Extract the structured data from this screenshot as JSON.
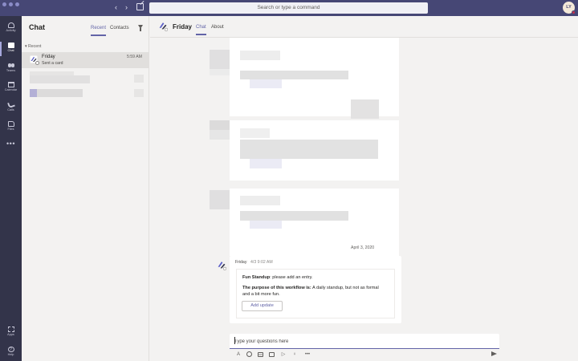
{
  "titlebar": {
    "back_icon": "chevron-left-icon",
    "forward_icon": "chevron-right-icon",
    "compose_icon": "compose-icon",
    "search_placeholder": "Search or type a command",
    "user_initials": "LY"
  },
  "appbar": {
    "items": [
      {
        "label": "Activity",
        "icon": "bell-icon"
      },
      {
        "label": "Chat",
        "icon": "chat-icon"
      },
      {
        "label": "Teams",
        "icon": "teams-icon"
      },
      {
        "label": "Calendar",
        "icon": "calendar-icon"
      },
      {
        "label": "Calls",
        "icon": "phone-icon"
      },
      {
        "label": "Files",
        "icon": "file-icon"
      }
    ],
    "more_label": "•••",
    "apps_label": "Apps",
    "help_label": "Help"
  },
  "chatlist": {
    "title": "Chat",
    "tabs": [
      "Recent",
      "Contacts"
    ],
    "section_label": "Recent",
    "items": [
      {
        "name": "Friday",
        "time": "5:59 AM",
        "preview": "Sent a card"
      }
    ]
  },
  "conversation": {
    "name": "Friday",
    "tabs": [
      "Chat",
      "About"
    ],
    "date_divider": "April 3, 2020",
    "message": {
      "sender": "Friday",
      "time": "4/3 9:02 AM",
      "card": {
        "line1_bold": "Fun Standup",
        "line1_rest": ": please add an entry.",
        "line2_bold": "The purpose of this workflow is:",
        "line2_rest": " A daily standup, but not as formal and a bit more fun.",
        "button_label": "Add update"
      }
    },
    "compose_placeholder": "Type your questions here",
    "compose_tools": [
      "format-icon",
      "emoji-icon",
      "gif-icon",
      "sticker-icon",
      "meet-icon",
      "praise-icon",
      "more-icon",
      "send-icon"
    ]
  },
  "colors": {
    "accent": "#6264a7",
    "titlebar": "#464775",
    "appbar": "#33344a"
  }
}
